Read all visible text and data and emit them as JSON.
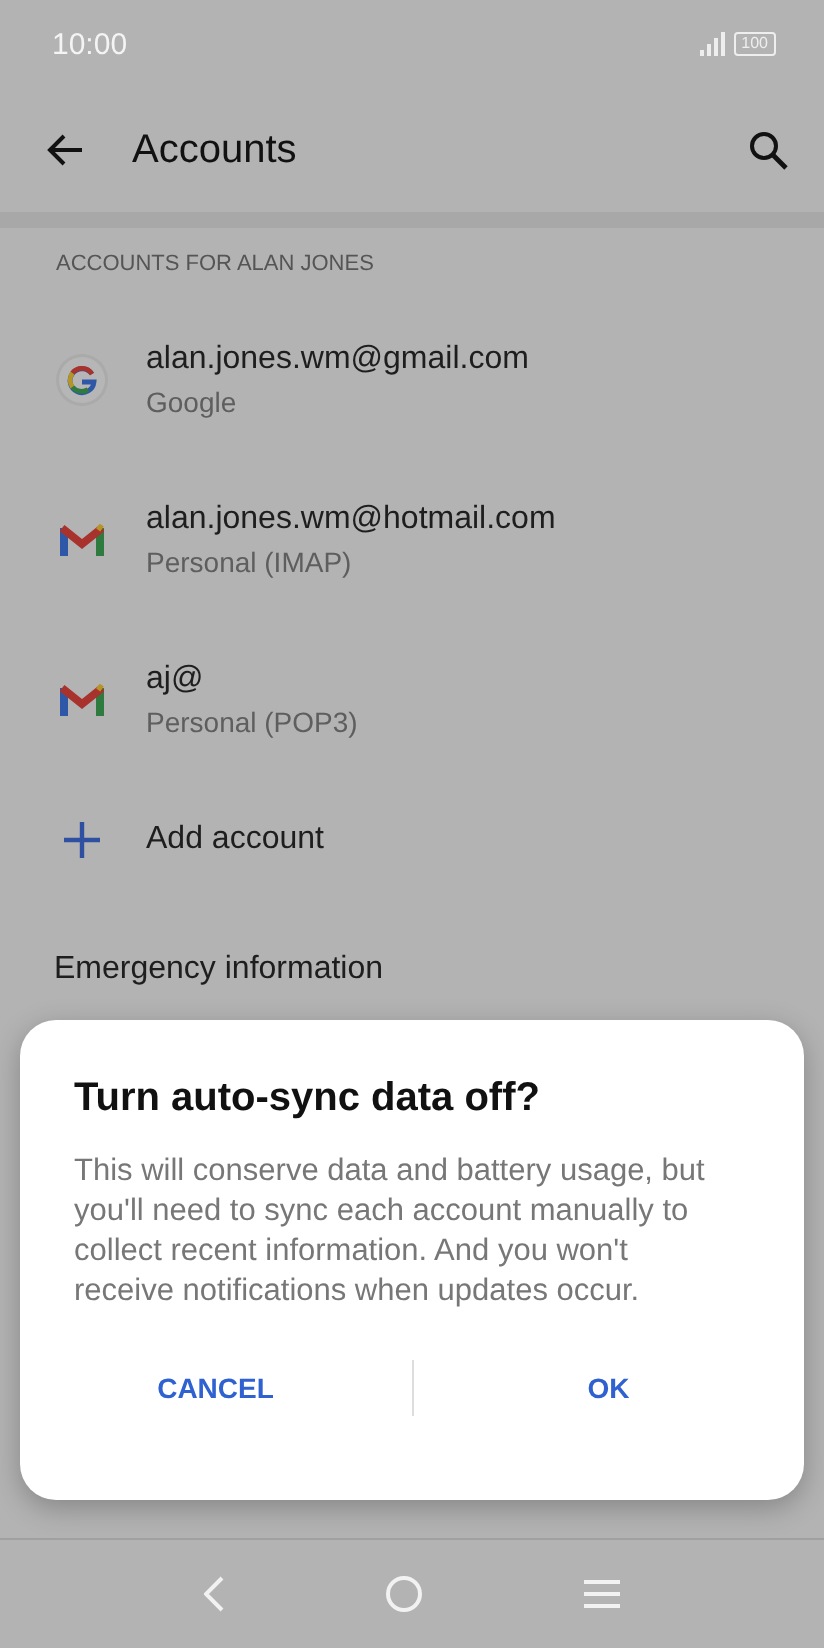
{
  "status_bar": {
    "time": "10:00",
    "battery": "100"
  },
  "app_bar": {
    "title": "Accounts"
  },
  "section_header": "ACCOUNTS FOR ALAN JONES",
  "accounts": [
    {
      "kind": "google",
      "title": "alan.jones.wm@gmail.com",
      "subtitle": "Google"
    },
    {
      "kind": "gmail",
      "title": "alan.jones.wm@hotmail.com",
      "subtitle": "Personal (IMAP)"
    },
    {
      "kind": "gmail",
      "title": "aj@",
      "subtitle": "Personal (POP3)"
    }
  ],
  "add_account": "Add account",
  "emergency": {
    "title": "Emergency information"
  },
  "dialog": {
    "title": "Turn auto-sync data off?",
    "message": "This will conserve data and battery usage, but you'll need to sync each account manually to collect recent information. And you won't receive notifications when updates occur.",
    "buttons": [
      "CANCEL",
      "OK"
    ]
  }
}
